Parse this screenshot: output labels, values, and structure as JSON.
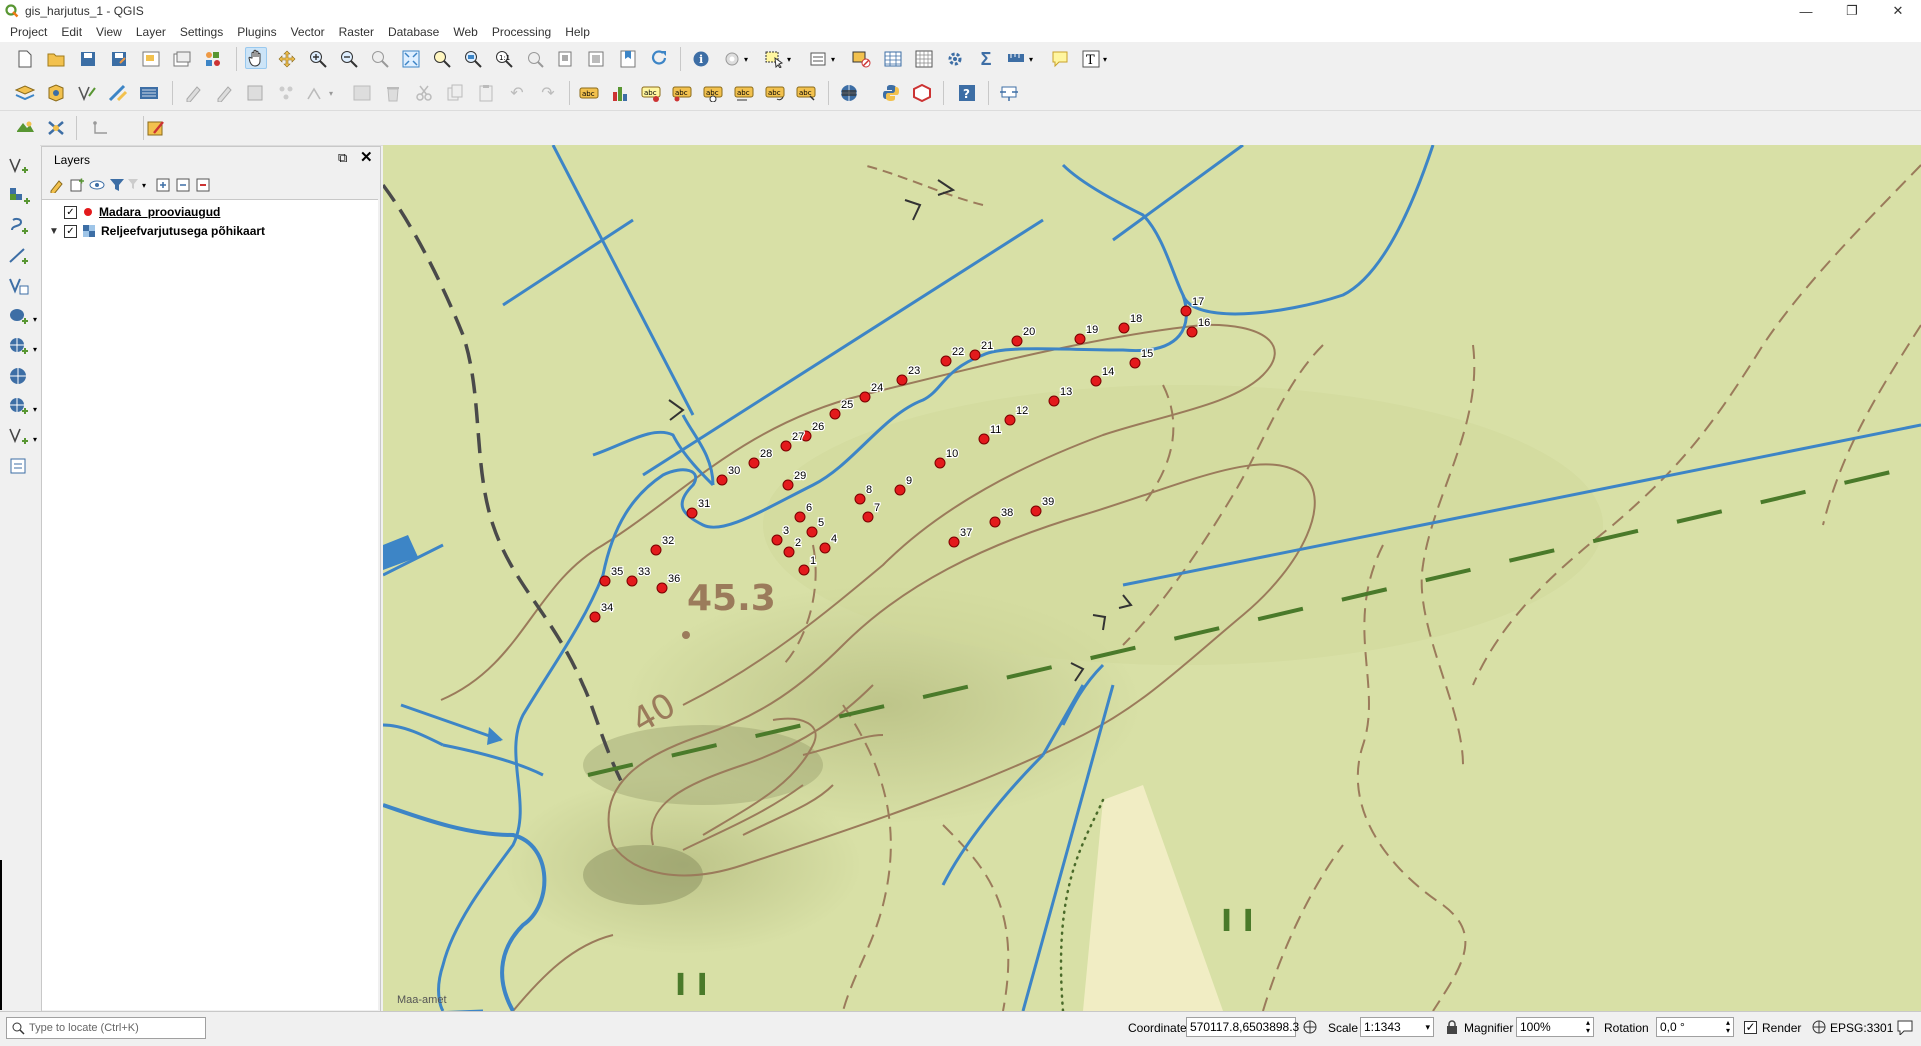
{
  "window": {
    "title": "gis_harjutus_1 - QGIS"
  },
  "menu": [
    "Project",
    "Edit",
    "View",
    "Layer",
    "Settings",
    "Plugins",
    "Vector",
    "Raster",
    "Database",
    "Web",
    "Processing",
    "Help"
  ],
  "layers_panel": {
    "title": "Layers",
    "layers": [
      {
        "name": "Madara_prooviaugud",
        "checked": true,
        "symbol_color": "#e31a1c"
      },
      {
        "name": "Reljeefvarjutusega põhikaart",
        "checked": true
      }
    ]
  },
  "map": {
    "attribution": "Maa-amet",
    "labels": {
      "elevation_top": "45.3",
      "elevation_contour": "40",
      "roman_a": "I I",
      "roman_b": "I I"
    },
    "points": [
      {
        "id": "1"
      },
      {
        "id": "2"
      },
      {
        "id": "3"
      },
      {
        "id": "4"
      },
      {
        "id": "5"
      },
      {
        "id": "6"
      },
      {
        "id": "7"
      },
      {
        "id": "8"
      },
      {
        "id": "9"
      },
      {
        "id": "10"
      },
      {
        "id": "11"
      },
      {
        "id": "12"
      },
      {
        "id": "13"
      },
      {
        "id": "14"
      },
      {
        "id": "15"
      },
      {
        "id": "16"
      },
      {
        "id": "17"
      },
      {
        "id": "18"
      },
      {
        "id": "19"
      },
      {
        "id": "20"
      },
      {
        "id": "21"
      },
      {
        "id": "22"
      },
      {
        "id": "23"
      },
      {
        "id": "24"
      },
      {
        "id": "25"
      },
      {
        "id": "26"
      },
      {
        "id": "27"
      },
      {
        "id": "28"
      },
      {
        "id": "29"
      },
      {
        "id": "30"
      },
      {
        "id": "31"
      },
      {
        "id": "32"
      },
      {
        "id": "33"
      },
      {
        "id": "34"
      },
      {
        "id": "35"
      },
      {
        "id": "36"
      },
      {
        "id": "37"
      },
      {
        "id": "38"
      },
      {
        "id": "39"
      }
    ],
    "colors": {
      "water": "#3d85c6",
      "contour": "#9b7b5b",
      "point": "#e31a1c",
      "boundary": "#4a7a2a"
    }
  },
  "statusbar": {
    "locator_placeholder": "Type to locate (Ctrl+K)",
    "coordinate_label": "Coordinate",
    "coordinate_value": "570117.8,6503898.3",
    "scale_label": "Scale",
    "scale_value": "1:1343",
    "magnifier_label": "Magnifier",
    "magnifier_value": "100%",
    "rotation_label": "Rotation",
    "rotation_value": "0,0 °",
    "render_label": "Render",
    "crs": "EPSG:3301"
  }
}
